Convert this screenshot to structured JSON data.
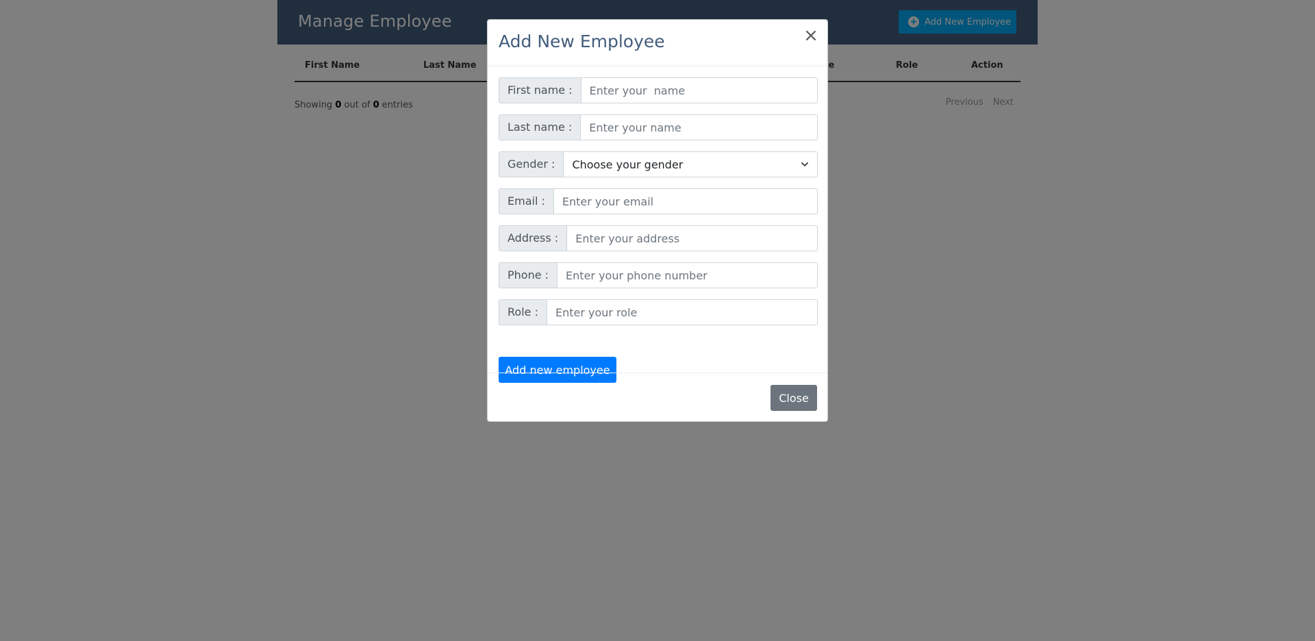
{
  "page": {
    "title": "Manage Employee",
    "add_button_label": "Add New Employee",
    "table_headers": [
      "First Name",
      "Last Name",
      "me",
      "Role",
      "Action"
    ],
    "showing_prefix": "Showing",
    "showing_count": "0",
    "showing_middle": "out of",
    "showing_total": "0",
    "showing_suffix": "entries",
    "pager_previous": "Previous",
    "pager_next": "Next"
  },
  "modal": {
    "title": "Add New Employee",
    "close_icon": "×",
    "fields": [
      {
        "label": "First name :",
        "placeholder": "Enter your  name"
      },
      {
        "label": "Last name :",
        "placeholder": "Enter your name"
      },
      {
        "label": "Gender :",
        "selected": "Choose your gender"
      },
      {
        "label": "Email :",
        "placeholder": "Enter your email"
      },
      {
        "label": "Address :",
        "placeholder": "Enter your address"
      },
      {
        "label": "Phone :",
        "placeholder": "Enter your phone number"
      },
      {
        "label": "Role :",
        "placeholder": "Enter your role"
      }
    ],
    "submit_label": "Add new employee",
    "close_label": "Close"
  },
  "colors": {
    "header_bg": "#435d7d",
    "primary": "#007bff",
    "secondary": "#6c757d",
    "accent": "#03a9f4"
  }
}
